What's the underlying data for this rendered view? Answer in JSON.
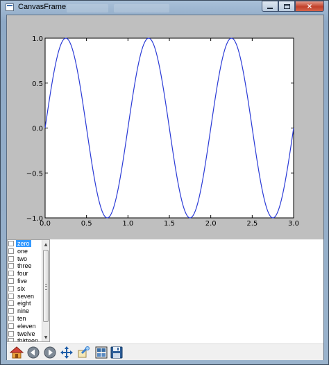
{
  "window": {
    "title": "CanvasFrame",
    "controls": {
      "minimize": "minimize",
      "maximize": "maximize",
      "close": "×"
    }
  },
  "chart_data": {
    "type": "line",
    "title": "",
    "xlabel": "",
    "ylabel": "",
    "xlim": [
      0.0,
      3.0
    ],
    "ylim": [
      -1.0,
      1.0
    ],
    "x_ticks": [
      "0.0",
      "0.5",
      "1.0",
      "1.5",
      "2.0",
      "2.5",
      "3.0"
    ],
    "y_ticks": [
      "1.0",
      "0.5",
      "0.0",
      "−0.5",
      "−1.0"
    ],
    "grid": false,
    "series": [
      {
        "function": "sin(2πx)",
        "x": [
          0.0,
          0.25,
          0.5,
          0.75,
          1.0,
          1.25,
          1.5,
          1.75,
          2.0,
          2.25,
          2.5,
          2.75,
          3.0
        ],
        "y": [
          0.0,
          1.0,
          0.0,
          -1.0,
          0.0,
          1.0,
          0.0,
          -1.0,
          0.0,
          1.0,
          0.0,
          -1.0,
          0.0
        ],
        "color": "#2b3bd6"
      }
    ]
  },
  "listbox": {
    "items": [
      "zero",
      "one",
      "two",
      "three",
      "four",
      "five",
      "six",
      "seven",
      "eight",
      "nine",
      "ten",
      "eleven",
      "twelve",
      "thirteen"
    ],
    "selected_index": 0
  },
  "toolbar": {
    "buttons": [
      "home-icon",
      "back-icon",
      "forward-icon",
      "pan-icon",
      "zoom-icon",
      "subplots-icon",
      "save-icon"
    ]
  }
}
